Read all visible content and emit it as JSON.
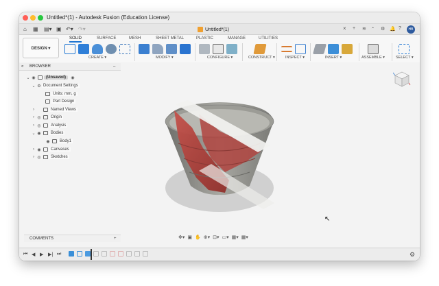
{
  "window": {
    "title": "Untitled*(1) - Autodesk Fusion (Education License)"
  },
  "tabbar": {
    "doc_tab": "Untitled*(1)",
    "close": "×",
    "avatar": "HB"
  },
  "toolbar": {
    "workspace": "DESIGN ▾",
    "tabs": [
      "SOLID",
      "SURFACE",
      "MESH",
      "SHEET METAL",
      "PLASTIC",
      "MANAGE",
      "UTILITIES"
    ],
    "groups": [
      "CREATE ▾",
      "MODIFY ▾",
      "CONFIGURE ▾",
      "CONSTRUCT ▾",
      "INSPECT ▾",
      "INSERT ▾",
      "ASSEMBLE ▾",
      "SELECT ▾"
    ]
  },
  "browser": {
    "title": "BROWSER",
    "collapse": "–",
    "items": [
      {
        "label": "(Unsaved)"
      },
      {
        "label": "Document Settings"
      },
      {
        "label": "Units: mm, g"
      },
      {
        "label": "Part Design"
      },
      {
        "label": "Named Views"
      },
      {
        "label": "Origin"
      },
      {
        "label": "Analysis"
      },
      {
        "label": "Bodies"
      },
      {
        "label": "Body1"
      },
      {
        "label": "Canvases"
      },
      {
        "label": "Sketches"
      }
    ]
  },
  "comments": {
    "label": "COMMENTS",
    "add": "+"
  },
  "colors": {
    "accent": "#1f76d2",
    "body_grey": "#8c8c88",
    "section_red": "#b8433e"
  },
  "icons": [
    "home-icon",
    "grid-icon",
    "file-icon",
    "save-icon",
    "undo-icon",
    "redo-icon",
    "orbit-icon",
    "pan-icon",
    "zoom-icon",
    "display-icon",
    "gear-icon",
    "viewcube-icon"
  ]
}
